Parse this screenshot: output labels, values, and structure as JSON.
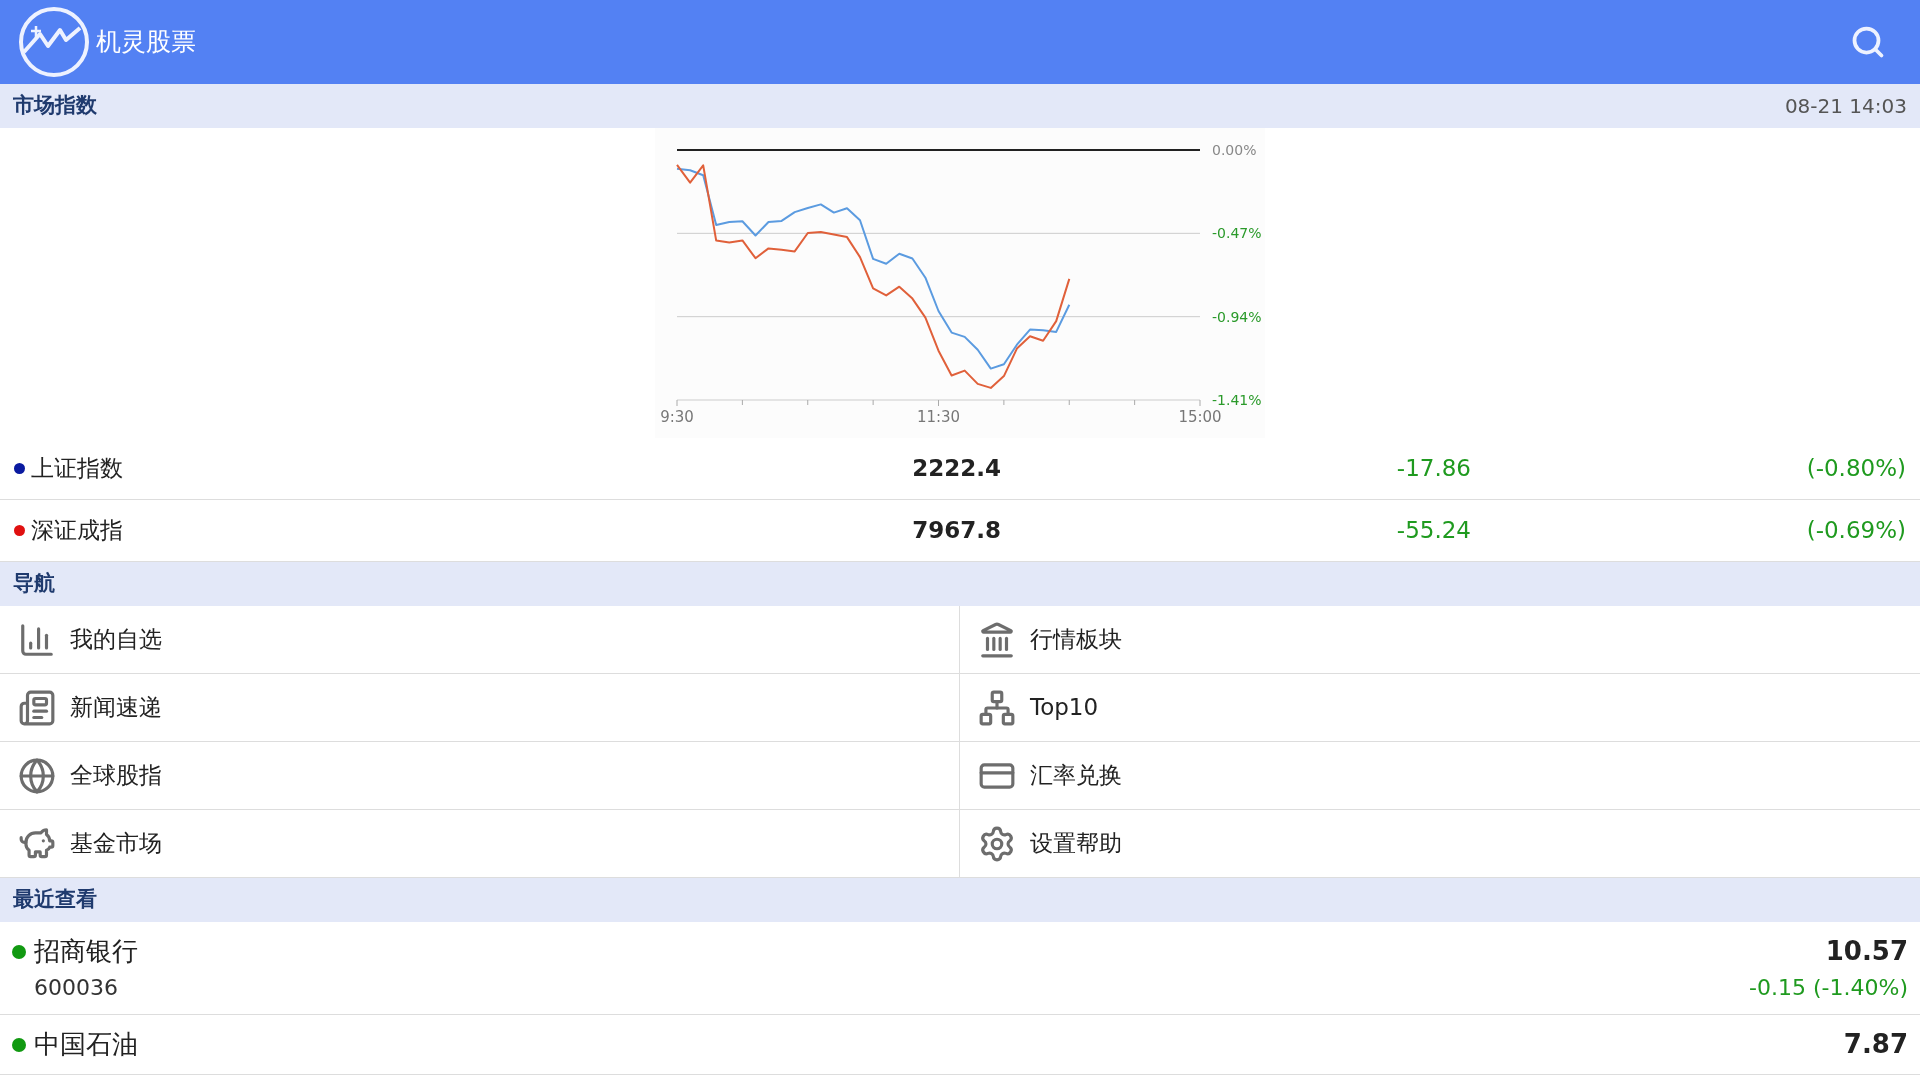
{
  "app_bar": {
    "title": "机灵股票"
  },
  "market": {
    "heading": "市场指数",
    "time": "08-21 14:03",
    "chart_data": {
      "type": "line",
      "categories": [
        "9:30",
        null,
        null,
        null,
        null,
        null,
        null,
        null,
        null,
        null,
        null,
        null,
        null,
        null,
        null,
        null,
        null,
        null,
        null,
        null,
        "11:30",
        null,
        null,
        null,
        null,
        null,
        null,
        null,
        null,
        null,
        null,
        null,
        null,
        null,
        null,
        null,
        null,
        null,
        null,
        null,
        "15:00"
      ],
      "yticks": [
        {
          "value": 0,
          "label": "0.00%"
        },
        {
          "value": -0.47,
          "label": "-0.47%"
        },
        {
          "value": -0.94,
          "label": "-0.94%"
        },
        {
          "value": -1.41,
          "label": "-1.41%"
        }
      ],
      "ylim": [
        -1.41,
        0
      ],
      "series": [
        {
          "color": "#5b9be0",
          "values": [
            -0.106,
            -0.114,
            -0.142,
            -0.423,
            -0.406,
            -0.402,
            -0.482,
            -0.406,
            -0.4,
            -0.35,
            -0.327,
            -0.307,
            -0.353,
            -0.328,
            -0.396,
            -0.614,
            -0.642,
            -0.585,
            -0.612,
            -0.72,
            -0.908,
            -1.03,
            -1.054,
            -1.127,
            -1.233,
            -1.208,
            -1.098,
            -1.013,
            -1.017,
            -1.026,
            -0.873,
            null,
            null,
            null,
            null,
            null,
            null,
            null,
            null,
            null,
            null
          ]
        },
        {
          "color": "#e0603a",
          "values": [
            -0.084,
            -0.184,
            -0.087,
            -0.511,
            -0.522,
            -0.51,
            -0.61,
            -0.555,
            -0.563,
            -0.572,
            -0.468,
            -0.463,
            -0.476,
            -0.491,
            -0.604,
            -0.78,
            -0.82,
            -0.771,
            -0.838,
            -0.945,
            -1.132,
            -1.272,
            -1.244,
            -1.319,
            -1.342,
            -1.275,
            -1.12,
            -1.05,
            -1.076,
            -0.965,
            -0.727,
            null,
            null,
            null,
            null,
            null,
            null,
            null,
            null,
            null,
            null
          ]
        }
      ]
    },
    "indices": [
      {
        "name": "上证指数",
        "color": "#0a1aa0",
        "value": "2222.4",
        "change": "-17.86",
        "percent": "(-0.80%)"
      },
      {
        "name": "深证成指",
        "color": "#e01010",
        "value": "7967.8",
        "change": "-55.24",
        "percent": "(-0.69%)"
      }
    ]
  },
  "navigation": {
    "heading": "导航",
    "items": [
      {
        "label": "我的自选"
      },
      {
        "label": "行情板块"
      },
      {
        "label": "新闻速递"
      },
      {
        "label": "Top10"
      },
      {
        "label": "全球股指"
      },
      {
        "label": "汇率兑换"
      },
      {
        "label": "基金市场"
      },
      {
        "label": "设置帮助"
      }
    ]
  },
  "recent": {
    "heading": "最近查看",
    "items": [
      {
        "name": "招商银行",
        "color": "#119911",
        "code": "600036",
        "price": "10.57",
        "change": "-0.15 (-1.40%)"
      },
      {
        "name": "中国石油",
        "color": "#119911",
        "price": "7.87"
      }
    ]
  }
}
